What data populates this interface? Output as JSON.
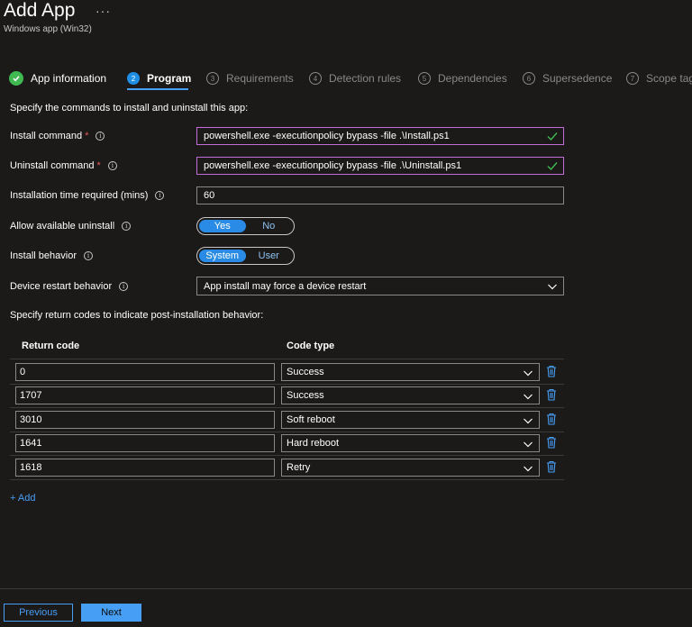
{
  "header": {
    "title": "Add App",
    "more": "···",
    "subtitle": "Windows app (Win32)"
  },
  "steps": [
    {
      "number": "",
      "label": "App information",
      "state": "done"
    },
    {
      "number": "2",
      "label": "Program",
      "state": "active"
    },
    {
      "number": "3",
      "label": "Requirements",
      "state": "pending"
    },
    {
      "number": "4",
      "label": "Detection rules",
      "state": "pending"
    },
    {
      "number": "5",
      "label": "Dependencies",
      "state": "pending"
    },
    {
      "number": "6",
      "label": "Supersedence",
      "state": "pending"
    },
    {
      "number": "7",
      "label": "Scope tag",
      "state": "pending"
    }
  ],
  "intro": "Specify the commands to install and uninstall this app:",
  "form": {
    "install_command": {
      "label": "Install command",
      "required": "*",
      "value": "powershell.exe -executionpolicy bypass -file .\\Install.ps1"
    },
    "uninstall_command": {
      "label": "Uninstall command",
      "required": "*",
      "value": "powershell.exe -executionpolicy bypass -file .\\Uninstall.ps1"
    },
    "install_time": {
      "label": "Installation time required (mins)",
      "value": "60"
    },
    "allow_uninstall": {
      "label": "Allow available uninstall",
      "on": "Yes",
      "off": "No",
      "selected": "Yes"
    },
    "install_behavior": {
      "label": "Install behavior",
      "on": "System",
      "off": "User",
      "selected": "System"
    },
    "restart_behavior": {
      "label": "Device restart behavior",
      "value": "App install may force a device restart"
    }
  },
  "return_codes": {
    "intro": "Specify return codes to indicate post-installation behavior:",
    "col_code": "Return code",
    "col_type": "Code type",
    "rows": [
      {
        "code": "0",
        "type": "Success"
      },
      {
        "code": "1707",
        "type": "Success"
      },
      {
        "code": "3010",
        "type": "Soft reboot"
      },
      {
        "code": "1641",
        "type": "Hard reboot"
      },
      {
        "code": "1618",
        "type": "Retry"
      }
    ],
    "add_label": "+ Add"
  },
  "footer": {
    "previous": "Previous",
    "next": "Next"
  },
  "colors": {
    "accent": "#479ef5",
    "focus_border": "#c26cd8",
    "success": "#3fb950",
    "required": "#e25a5a"
  },
  "icons": {
    "step_done": "checkmark-circle-icon",
    "info": "info-icon",
    "valid": "checkmark-icon",
    "dropdown": "chevron-down-icon",
    "delete": "trash-icon"
  }
}
